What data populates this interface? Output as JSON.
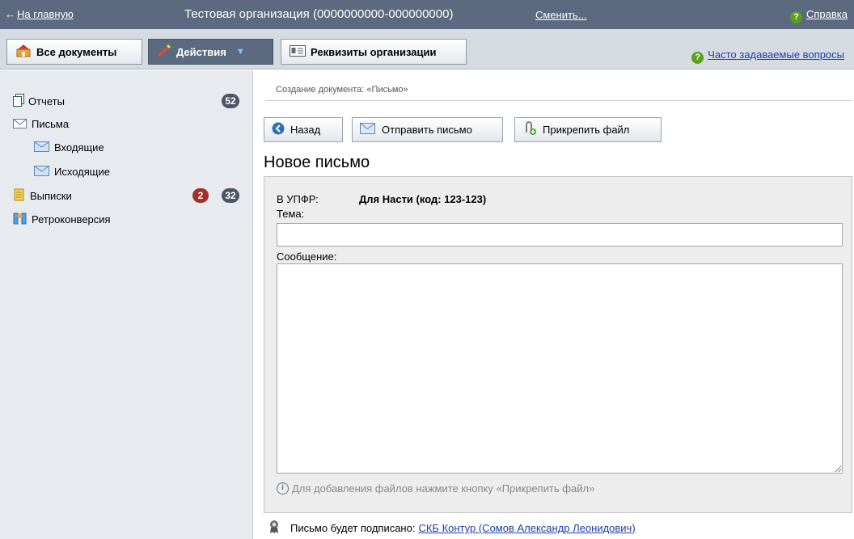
{
  "topbar": {
    "home_arrow": "←",
    "home_label": "На главную",
    "org_title": "Тестовая организация (0000000000-000000000)",
    "change_label": "Сменить...",
    "help_label": "Справка",
    "help_glyph": "?"
  },
  "toolbar": {
    "all_docs_label": "Все документы",
    "actions_label": "Действия",
    "requisites_label": "Реквизиты организации",
    "faq_label": "Часто задаваемые вопросы",
    "faq_glyph": "?"
  },
  "sidebar": {
    "items": [
      {
        "label": "Отчеты",
        "badge": "52",
        "icon": "reports-icon"
      },
      {
        "label": "Письма",
        "icon": "letters-icon"
      },
      {
        "label": "Входящие",
        "icon": "inbox-icon"
      },
      {
        "label": "Исходящие",
        "icon": "outbox-icon"
      },
      {
        "label": "Выписки",
        "badge_alert": "2",
        "badge": "32",
        "icon": "statements-icon"
      },
      {
        "label": "Ретроконверсия",
        "icon": "retroconversion-icon"
      }
    ]
  },
  "main": {
    "breadcrumb": "Создание документа: «Письмо»",
    "back_label": "Назад",
    "send_label": "Отправить письмо",
    "attach_label": "Прикрепить файл",
    "title": "Новое письмо",
    "to_label": "В УПФР:",
    "to_value": "Для Насти (код: 123-123)",
    "subject_label": "Тема:",
    "subject_value": "",
    "message_label": "Сообщение:",
    "message_value": "",
    "hint": "Для добавления файлов нажмите кнопку «Прикрепить файл»",
    "hint_glyph": "i",
    "sign_text": "Письмо будет подписано:",
    "sign_link": "СКБ Контур (Сомов Александр Леонидович)"
  },
  "colors": {
    "topbar_bg": "#5b6a7e",
    "sidebar_bg": "#e7ebf0",
    "link": "#1a3fb0",
    "help_green": "#5aa01e",
    "badge_dark": "#4b5566",
    "badge_red": "#a33028"
  }
}
